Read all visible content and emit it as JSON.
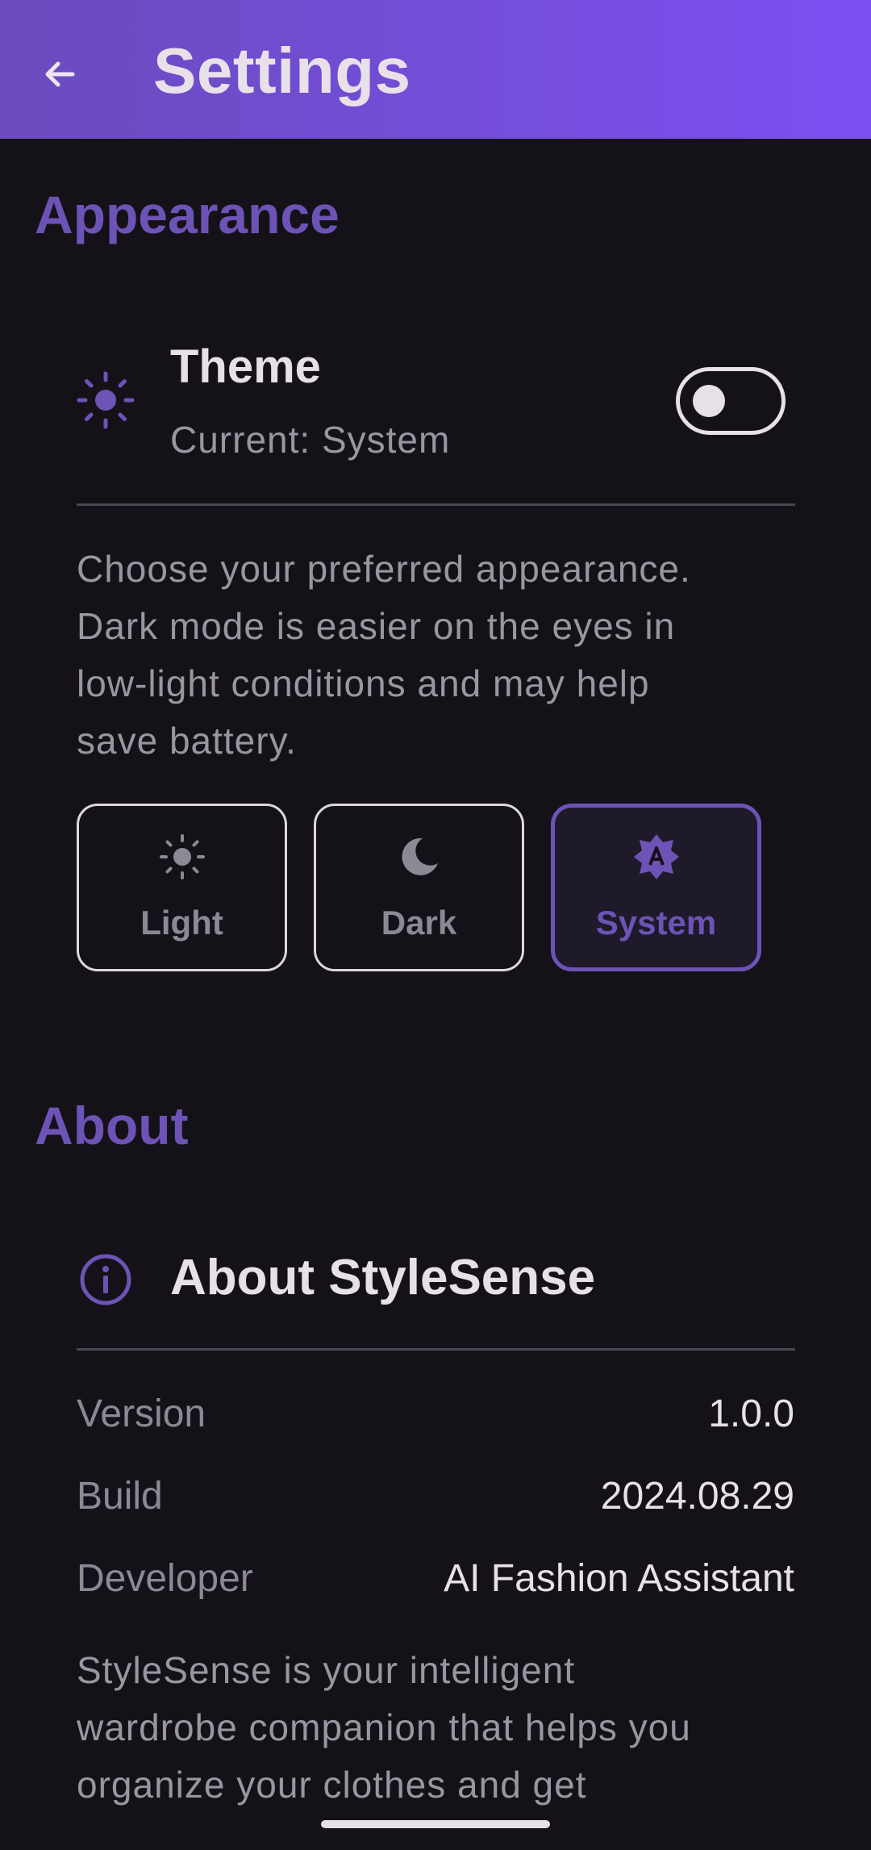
{
  "appbar": {
    "back_icon": "arrow-back-icon",
    "title": "Settings"
  },
  "appearance": {
    "section_title": "Appearance",
    "theme": {
      "icon": "sun-icon",
      "title": "Theme",
      "subtitle": "Current: System",
      "toggle_on": false
    },
    "description_lines": [
      "Choose your preferred appearance.",
      "Dark mode is easier on the eyes in",
      "low-light conditions and may help",
      "save battery."
    ],
    "options": [
      {
        "label": "Light",
        "icon": "light-mode-icon",
        "selected": false
      },
      {
        "label": "Dark",
        "icon": "dark-mode-icon",
        "selected": false
      },
      {
        "label": "System",
        "icon": "brightness-auto-icon",
        "selected": true
      }
    ]
  },
  "about": {
    "section_title": "About",
    "card_title": "About StyleSense",
    "icon": "info-icon",
    "rows": [
      {
        "label": "Version",
        "value": "1.0.0"
      },
      {
        "label": "Build",
        "value": "2024.08.29"
      },
      {
        "label": "Developer",
        "value": "AI Fashion Assistant"
      }
    ],
    "description_lines": [
      "StyleSense is your intelligent",
      "wardrobe companion that helps you",
      "organize your clothes and get"
    ]
  },
  "colors": {
    "accent": "#6d53b6",
    "appbar_gradient_start": "#6a4cbd",
    "appbar_gradient_end": "#7b4ff2",
    "background": "#141218"
  }
}
